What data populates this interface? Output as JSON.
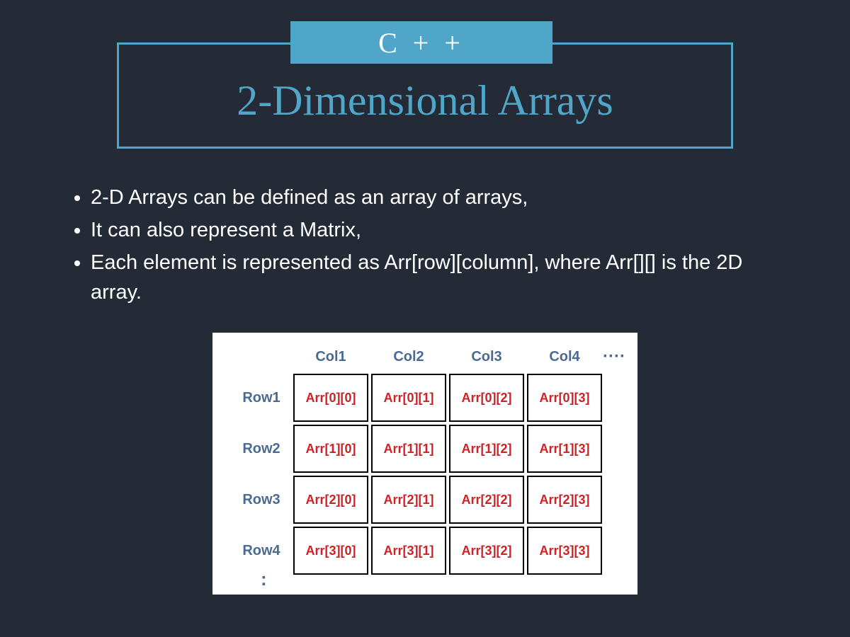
{
  "header": {
    "badge": "C + +",
    "title": "2-Dimensional Arrays"
  },
  "bullets": [
    "2-D Arrays can be defined as an array of arrays,",
    "It can also represent a Matrix,",
    "Each element is represented as Arr[row][column], where Arr[][] is the 2D array."
  ],
  "matrix": {
    "cols": [
      "Col1",
      "Col2",
      "Col3",
      "Col4"
    ],
    "rows": [
      "Row1",
      "Row2",
      "Row3",
      "Row4"
    ],
    "hdots": "····",
    "vdots": ":",
    "cells": [
      [
        "Arr[0][0]",
        "Arr[0][1]",
        "Arr[0][2]",
        "Arr[0][3]"
      ],
      [
        "Arr[1][0]",
        "Arr[1][1]",
        "Arr[1][2]",
        "Arr[1][3]"
      ],
      [
        "Arr[2][0]",
        "Arr[2][1]",
        "Arr[2][2]",
        "Arr[2][3]"
      ],
      [
        "Arr[3][0]",
        "Arr[3][1]",
        "Arr[3][2]",
        "Arr[3][3]"
      ]
    ]
  }
}
